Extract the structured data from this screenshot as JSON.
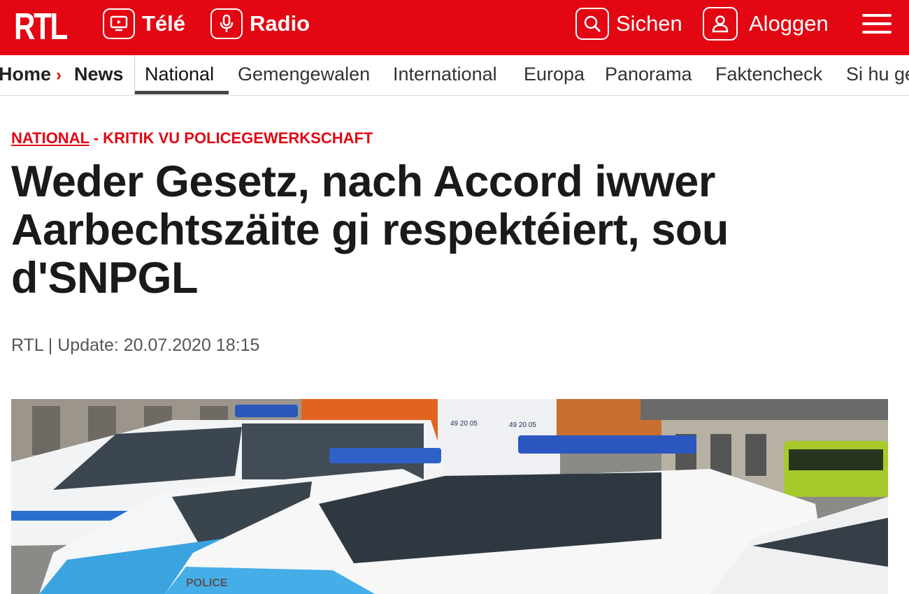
{
  "header": {
    "logo": "RTL",
    "tele_label": "Télé",
    "radio_label": "Radio",
    "search_label": "Sichen",
    "login_label": "Aloggen"
  },
  "subnav": {
    "home": "Home",
    "news": "News",
    "items": [
      "National",
      "Gemengewalen",
      "International",
      "Europa",
      "Panorama",
      "Faktencheck",
      "Si hu ge"
    ],
    "active": "National"
  },
  "article": {
    "category": "NATIONAL",
    "kicker": " - KRITIK VU POLICEGEWERKSCHAFT",
    "headline": "Weder Gesetz, nach Accord iwwer Aarbechtszäite gi respektéiert, sou d'SNPGL",
    "meta": "RTL | Update: 20.07.2020 18:15"
  },
  "photo": {
    "container_text_1": "49 20 05",
    "container_text_2": "49 20 05",
    "car_badge": "POLICE"
  },
  "colors": {
    "brand": "#e30613"
  }
}
